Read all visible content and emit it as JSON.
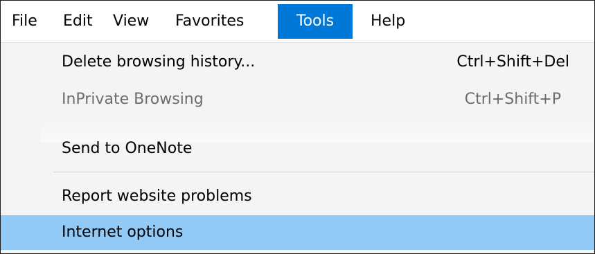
{
  "menubar": {
    "items": [
      {
        "label": "File"
      },
      {
        "label": "Edit"
      },
      {
        "label": "View"
      },
      {
        "label": "Favorites"
      },
      {
        "label": "Tools"
      },
      {
        "label": "Help"
      }
    ],
    "active_item": "Tools",
    "active_color": "#0078d7"
  },
  "tools_menu": {
    "items": [
      {
        "label": "Delete browsing history...",
        "shortcut": "Ctrl+Shift+Del",
        "state": "enabled"
      },
      {
        "label": "InPrivate Browsing",
        "shortcut": "Ctrl+Shift+P",
        "state": "disabled"
      },
      {
        "label": "Send to OneNote",
        "shortcut": "",
        "state": "enabled"
      },
      {
        "label": "Report website problems",
        "shortcut": "",
        "state": "enabled"
      },
      {
        "label": "Internet options",
        "shortcut": "",
        "state": "highlighted"
      }
    ],
    "highlight_color": "#91c9f7",
    "disabled_text_color": "#6d6d6d"
  }
}
